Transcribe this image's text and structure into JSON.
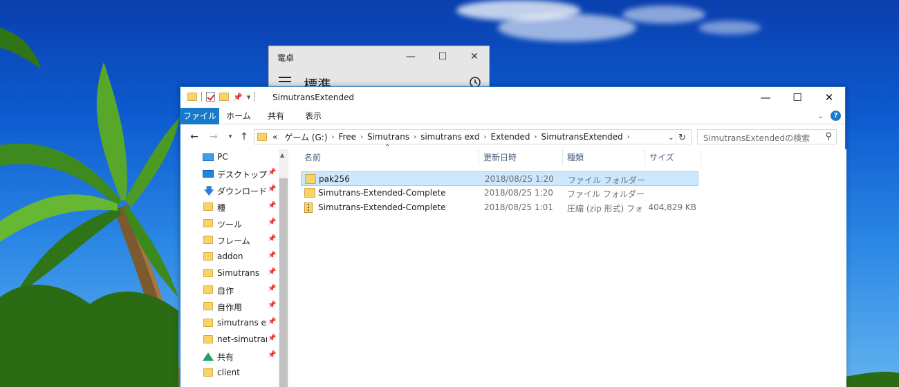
{
  "calculator": {
    "title": "電卓",
    "mode": "標準"
  },
  "explorer": {
    "title": "SimutransExtended",
    "ribbon_tabs": [
      "ファイル",
      "ホーム",
      "共有",
      "表示"
    ],
    "address": {
      "overflow": "«",
      "crumbs": [
        "ゲーム (G:)",
        "Free",
        "Simutrans",
        "simutrans exd",
        "Extended",
        "SimutransExtended"
      ]
    },
    "search_placeholder": "SimutransExtendedの検索",
    "columns": [
      "名前",
      "更新日時",
      "種類",
      "サイズ"
    ],
    "files": [
      {
        "name": "pak256",
        "date": "2018/08/25 1:20",
        "type": "ファイル フォルダー",
        "size": "",
        "icon": "folder-icon",
        "selected": true
      },
      {
        "name": "Simutrans-Extended-Complete",
        "date": "2018/08/25 1:20",
        "type": "ファイル フォルダー",
        "size": "",
        "icon": "folder-icon",
        "selected": false
      },
      {
        "name": "Simutrans-Extended-Complete",
        "date": "2018/08/25 1:01",
        "type": "圧縮 (zip 形式) フォ",
        "size": "404,829 KB",
        "icon": "zip-folder-icon",
        "selected": false
      }
    ],
    "nav_items": [
      {
        "label": "PC",
        "icon": "pc-icon",
        "pinned": false
      },
      {
        "label": "デスクトップ",
        "icon": "desktop-icon",
        "pinned": true
      },
      {
        "label": "ダウンロード",
        "icon": "download-icon",
        "pinned": true
      },
      {
        "label": "種",
        "icon": "folder-icon",
        "pinned": true
      },
      {
        "label": "ツール",
        "icon": "folder-icon",
        "pinned": true
      },
      {
        "label": "フレーム",
        "icon": "folder-icon",
        "pinned": true
      },
      {
        "label": "addon",
        "icon": "folder-icon",
        "pinned": true
      },
      {
        "label": "Simutrans",
        "icon": "folder-icon",
        "pinned": true
      },
      {
        "label": "自作",
        "icon": "folder-icon",
        "pinned": true
      },
      {
        "label": "自作用",
        "icon": "folder-icon",
        "pinned": true
      },
      {
        "label": "simutrans exd",
        "icon": "folder-icon",
        "pinned": true
      },
      {
        "label": "net-simutrans",
        "icon": "folder-icon",
        "pinned": true
      },
      {
        "label": "共有",
        "icon": "google-drive-icon",
        "pinned": true
      },
      {
        "label": "client",
        "icon": "folder-icon",
        "pinned": false
      }
    ]
  }
}
